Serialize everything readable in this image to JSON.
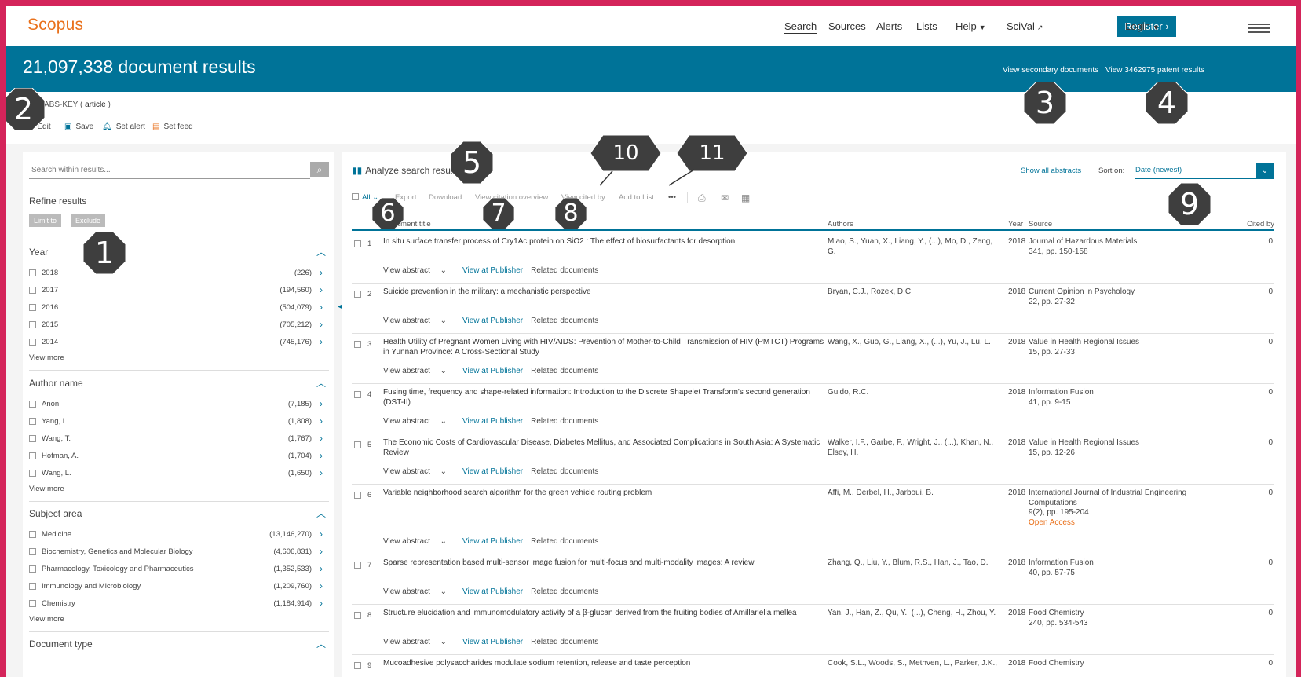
{
  "nav": {
    "logo": "Scopus",
    "search": "Search",
    "sources": "Sources",
    "alerts": "Alerts",
    "lists": "Lists",
    "help": "Help",
    "scival": "SciVal",
    "register": "Register",
    "login": "Login"
  },
  "banner": {
    "result_count": "21,097,338 document results",
    "secondary": "View secondary documents",
    "patent": "View 3462975 patent results"
  },
  "query": {
    "text_prefix": "ABS-KEY (",
    "term": "article",
    "text_suffix": ")",
    "edit": "Edit",
    "save": "Save",
    "set_alert": "Set alert",
    "set_feed": "Set feed"
  },
  "refine": {
    "search_placeholder": "Search within results...",
    "title": "Refine results",
    "limit_to": "Limit to",
    "exclude": "Exclude",
    "view_more": "View more",
    "facets": [
      {
        "title": "Year",
        "items": [
          {
            "label": "2018",
            "count": "(226)"
          },
          {
            "label": "2017",
            "count": "(194,560)"
          },
          {
            "label": "2016",
            "count": "(504,079)"
          },
          {
            "label": "2015",
            "count": "(705,212)"
          },
          {
            "label": "2014",
            "count": "(745,176)"
          }
        ]
      },
      {
        "title": "Author name",
        "items": [
          {
            "label": "Anon",
            "count": "(7,185)"
          },
          {
            "label": "Yang, L.",
            "count": "(1,808)"
          },
          {
            "label": "Wang, T.",
            "count": "(1,767)"
          },
          {
            "label": "Hofman, A.",
            "count": "(1,704)"
          },
          {
            "label": "Wang, L.",
            "count": "(1,650)"
          }
        ]
      },
      {
        "title": "Subject area",
        "items": [
          {
            "label": "Medicine",
            "count": "(13,146,270)"
          },
          {
            "label": "Biochemistry, Genetics and Molecular Biology",
            "count": "(4,606,831)"
          },
          {
            "label": "Pharmacology, Toxicology and Pharmaceutics",
            "count": "(1,352,533)"
          },
          {
            "label": "Immunology and Microbiology",
            "count": "(1,209,760)"
          },
          {
            "label": "Chemistry",
            "count": "(1,184,914)"
          }
        ]
      },
      {
        "title": "Document type",
        "items": []
      }
    ]
  },
  "results": {
    "analyze": "Analyze search results",
    "show_abstracts": "Show all abstracts",
    "sort_label": "Sort on:",
    "sort_value": "Date (newest)",
    "toolbar": {
      "all": "All",
      "export": "Export",
      "download": "Download",
      "citation_overview": "View citation overview",
      "cited_by": "View cited by",
      "add_to_list": "Add to List",
      "more": "•••"
    },
    "columns": {
      "doc_title": "Document title",
      "authors": "Authors",
      "year": "Year",
      "source": "Source",
      "cited_by": "Cited by"
    },
    "row_links": {
      "view_abstract": "View abstract",
      "view_publisher": "View at Publisher",
      "related": "Related documents"
    },
    "rows": [
      {
        "num": "1",
        "title": "In situ surface transfer process of Cry1Ac protein on SiO2 : The effect of biosurfactants for desorption",
        "authors": "Miao, S., Yuan, X., Liang, Y., (...), Mo, D., Zeng, G.",
        "year": "2018",
        "source": "Journal of Hazardous Materials",
        "pages": "341, pp. 150-158",
        "oa": "",
        "cited": "0"
      },
      {
        "num": "2",
        "title": "Suicide prevention in the military: a mechanistic perspective",
        "authors": "Bryan, C.J., Rozek, D.C.",
        "year": "2018",
        "source": "Current Opinion in Psychology",
        "pages": "22, pp. 27-32",
        "oa": "",
        "cited": "0"
      },
      {
        "num": "3",
        "title": "Health Utility of Pregnant Women Living with HIV/AIDS: Prevention of Mother-to-Child Transmission of HIV (PMTCT) Programs in Yunnan Province: A Cross-Sectional Study",
        "authors": "Wang, X., Guo, G., Liang, X., (...), Yu, J., Lu, L.",
        "year": "2018",
        "source": "Value in Health Regional Issues",
        "pages": "15, pp. 27-33",
        "oa": "",
        "cited": "0"
      },
      {
        "num": "4",
        "title": "Fusing time, frequency and shape-related information: Introduction to the Discrete Shapelet Transform's second generation (DST-II)",
        "authors": "Guido, R.C.",
        "year": "2018",
        "source": "Information Fusion",
        "pages": "41, pp. 9-15",
        "oa": "",
        "cited": "0"
      },
      {
        "num": "5",
        "title": "The Economic Costs of Cardiovascular Disease, Diabetes Mellitus, and Associated Complications in South Asia: A Systematic Review",
        "authors": "Walker, I.F., Garbe, F., Wright, J., (...), Khan, N., Elsey, H.",
        "year": "2018",
        "source": "Value in Health Regional Issues",
        "pages": "15, pp. 12-26",
        "oa": "",
        "cited": "0"
      },
      {
        "num": "6",
        "title": "Variable neighborhood search algorithm for the green vehicle routing problem",
        "authors": "Affi, M., Derbel, H., Jarboui, B.",
        "year": "2018",
        "source": "International Journal of Industrial Engineering Computations",
        "pages": "9(2), pp. 195-204",
        "oa": "Open Access",
        "cited": "0"
      },
      {
        "num": "7",
        "title": "Sparse representation based multi-sensor image fusion for multi-focus and multi-modality images: A review",
        "authors": "Zhang, Q., Liu, Y., Blum, R.S., Han, J., Tao, D.",
        "year": "2018",
        "source": "Information Fusion",
        "pages": "40, pp. 57-75",
        "oa": "",
        "cited": "0"
      },
      {
        "num": "8",
        "title": "Structure elucidation and immunomodulatory activity of a β-glucan derived from the fruiting bodies of Amillariella mellea",
        "authors": "Yan, J., Han, Z., Qu, Y., (...), Cheng, H., Zhou, Y.",
        "year": "2018",
        "source": "Food Chemistry",
        "pages": "240, pp. 534-543",
        "oa": "",
        "cited": "0"
      },
      {
        "num": "9",
        "title": "Mucoadhesive polysaccharides modulate sodium retention, release and taste perception",
        "authors": "Cook, S.L., Woods, S., Methven, L., Parker, J.K.,",
        "year": "2018",
        "source": "Food Chemistry",
        "pages": "",
        "oa": "",
        "cited": "0"
      }
    ]
  },
  "callouts": [
    "1",
    "2",
    "3",
    "4",
    "5",
    "6",
    "7",
    "8",
    "9",
    "10",
    "11"
  ],
  "colors": {
    "brand": "#007398",
    "logo": "#e9711c",
    "frame": "#d4245a",
    "callout": "#3e3e3e"
  }
}
